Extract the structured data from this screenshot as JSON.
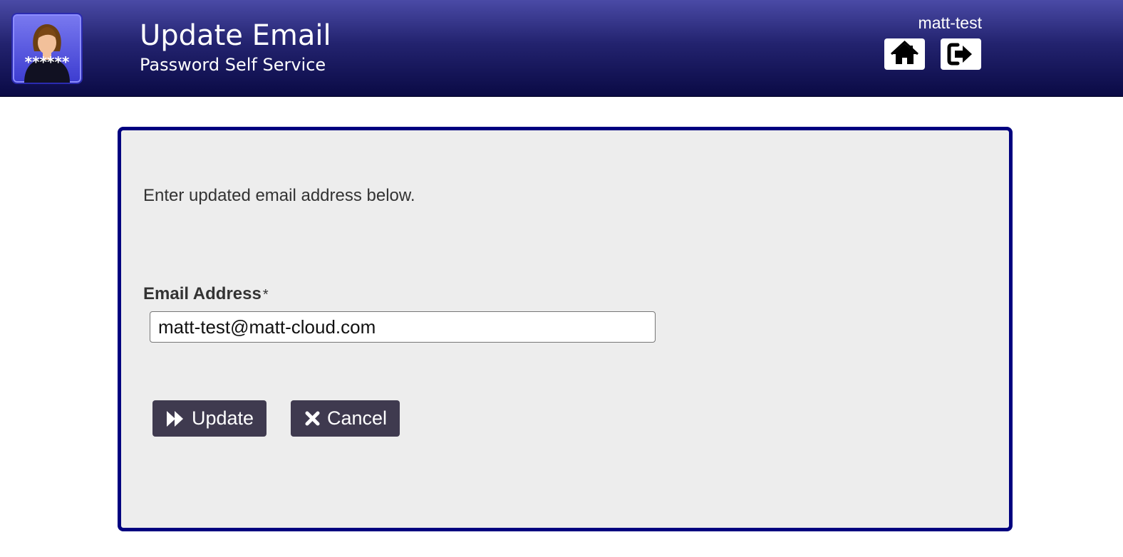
{
  "header": {
    "title": "Update Email",
    "subtitle": "Password Self Service",
    "username": "matt-test",
    "logo_icon": "password-user-icon",
    "logo_text": "******",
    "home_icon": "home-icon",
    "logout_icon": "logout-icon"
  },
  "form": {
    "instructions": "Enter updated email address below.",
    "email_label": "Email Address",
    "required_mark": "*",
    "email_value": "matt-test@matt-cloud.com",
    "update_label": "Update",
    "update_icon": "fast-forward-icon",
    "cancel_label": "Cancel",
    "cancel_icon": "close-icon"
  },
  "colors": {
    "header_top": "#4a4aa6",
    "header_bottom": "#0a0a45",
    "panel_border": "#00007f",
    "panel_background": "#ededed",
    "button_background": "#3f3a4f"
  }
}
